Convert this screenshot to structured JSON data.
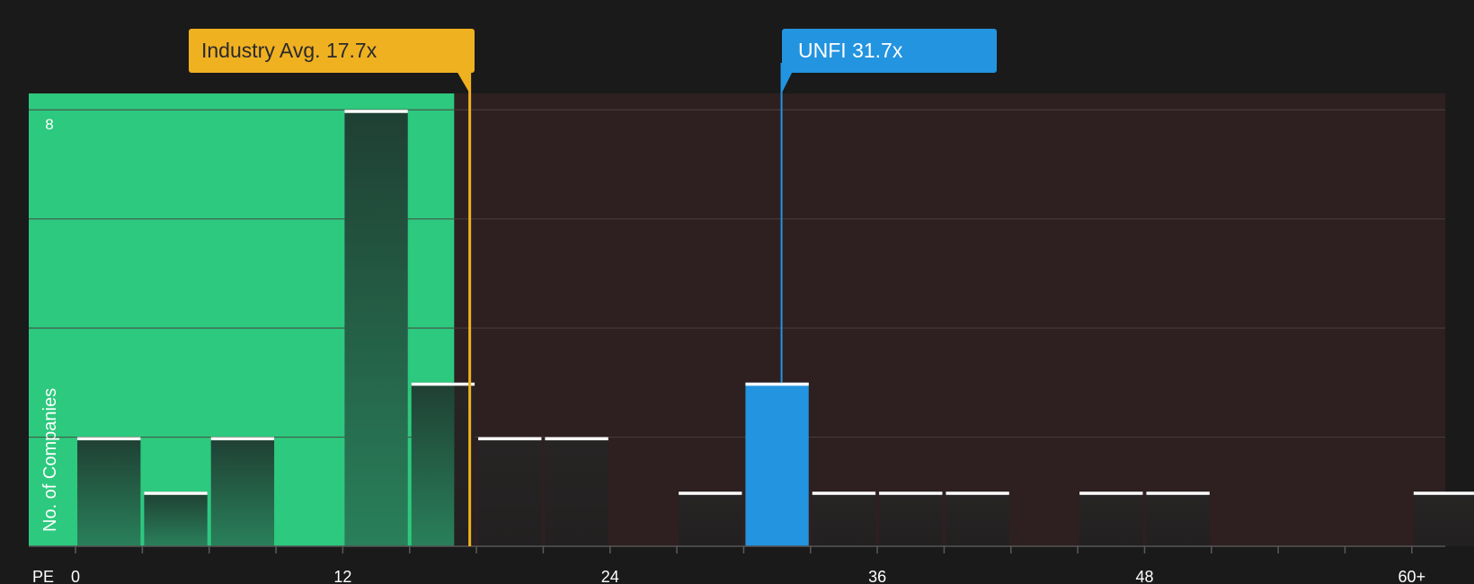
{
  "chart_data": {
    "type": "bar",
    "xlabel": "PE",
    "ylabel": "No. of Companies",
    "x_ticks": [
      "0",
      "12",
      "24",
      "36",
      "48",
      "60+"
    ],
    "x_tick_values": [
      0,
      12,
      24,
      36,
      48,
      60
    ],
    "y_tick_label": "8",
    "xlim": [
      -2.1,
      61.5
    ],
    "ylim": [
      0,
      8.3
    ],
    "bin_width": 3,
    "bins": [
      {
        "start": 0,
        "count": 2
      },
      {
        "start": 3,
        "count": 1
      },
      {
        "start": 6,
        "count": 2
      },
      {
        "start": 9,
        "count": 0
      },
      {
        "start": 12,
        "count": 8
      },
      {
        "start": 15,
        "count": 3
      },
      {
        "start": 18,
        "count": 2
      },
      {
        "start": 21,
        "count": 2
      },
      {
        "start": 24,
        "count": 0
      },
      {
        "start": 27,
        "count": 1
      },
      {
        "start": 30,
        "count": 3,
        "highlight": true
      },
      {
        "start": 33,
        "count": 1
      },
      {
        "start": 36,
        "count": 1
      },
      {
        "start": 39,
        "count": 1
      },
      {
        "start": 42,
        "count": 0
      },
      {
        "start": 45,
        "count": 1
      },
      {
        "start": 48,
        "count": 1
      },
      {
        "start": 51,
        "count": 0
      },
      {
        "start": 54,
        "count": 0
      },
      {
        "start": 57,
        "count": 0
      },
      {
        "start": 60,
        "count": 1
      }
    ],
    "industry_avg": {
      "label": "Industry Avg.",
      "value_text": "17.7x",
      "value": 17.7
    },
    "company": {
      "label": "UNFI",
      "value_text": "31.7x",
      "value": 31.7
    },
    "undervalued_until": 17
  },
  "colors": {
    "background": "#1a1a1a",
    "green_zone": "#2dc97e",
    "red_zone": "#2e2020",
    "industry": "#f0b121",
    "company": "#2394e0",
    "bar_dark": "#252525",
    "bar_cap": "#ffffff",
    "grid": "#4a4040",
    "text": "#ffffff"
  }
}
